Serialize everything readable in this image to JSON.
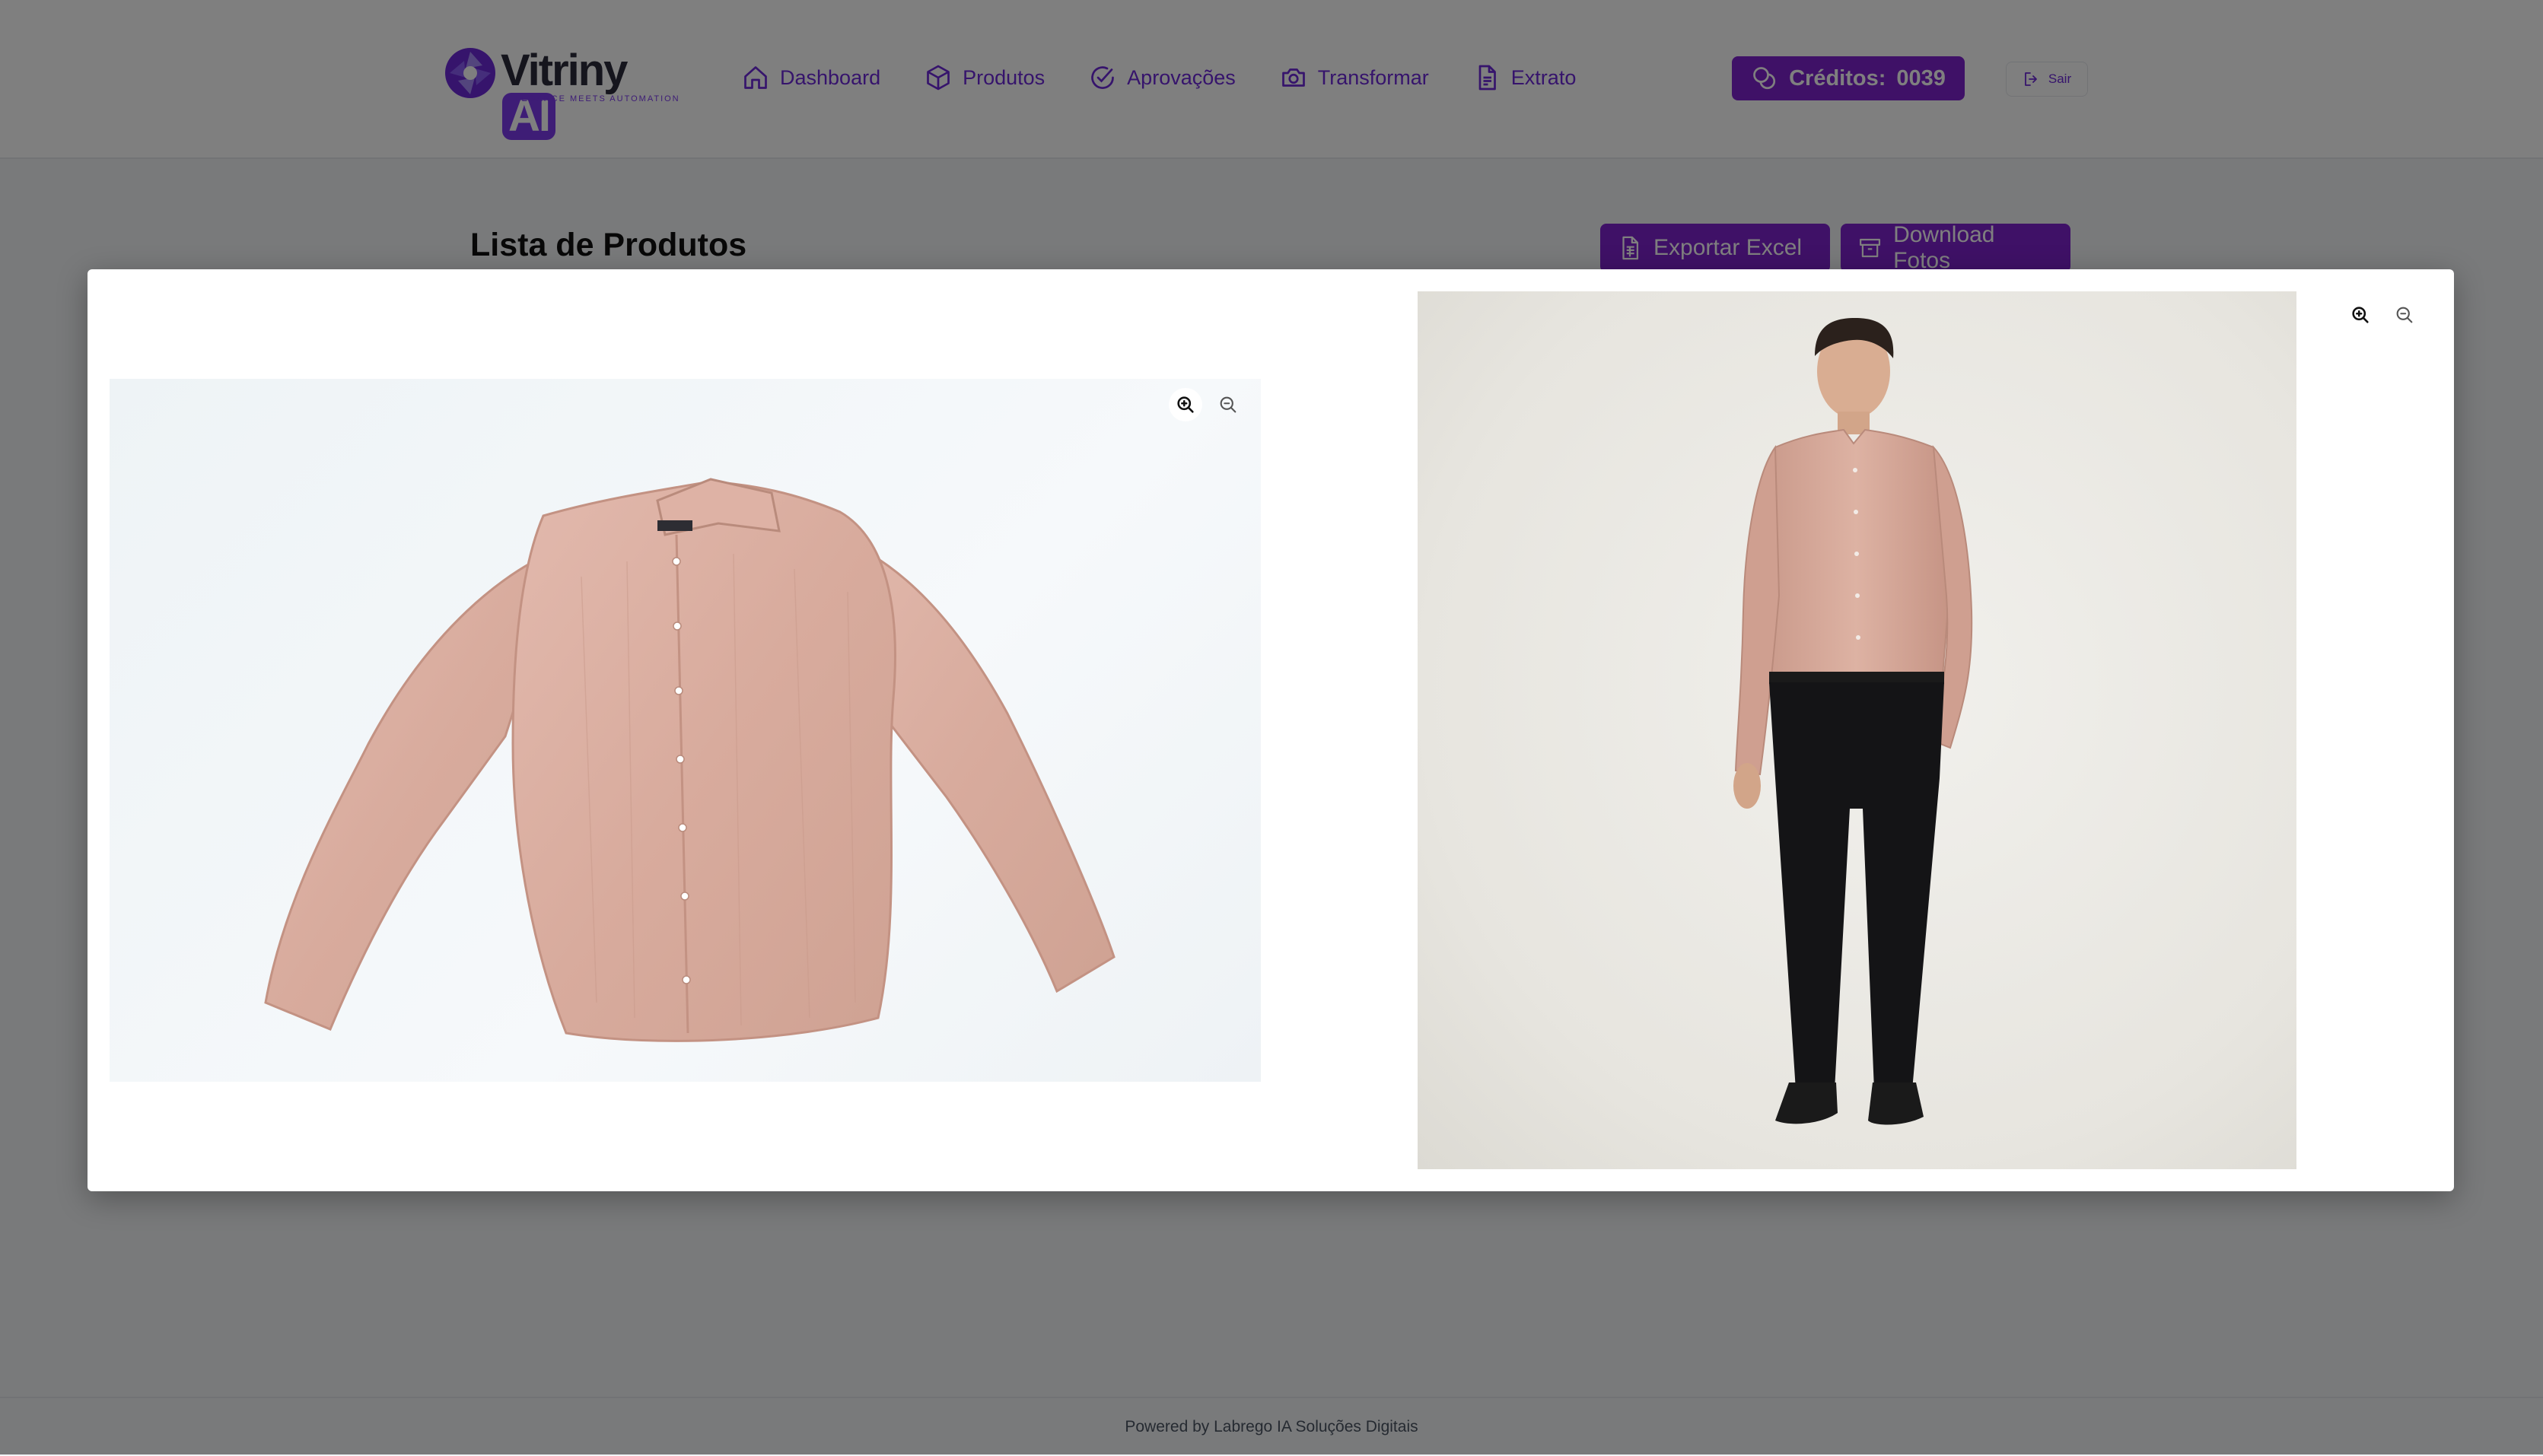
{
  "header": {
    "logo": {
      "word": "Vitriny",
      "badge": "AI",
      "tagline": "ELEGANCE MEETS AUTOMATION"
    },
    "nav": [
      {
        "label": "Dashboard",
        "icon": "home-icon"
      },
      {
        "label": "Produtos",
        "icon": "box-icon"
      },
      {
        "label": "Aprovações",
        "icon": "check-circle-icon"
      },
      {
        "label": "Transformar",
        "icon": "camera-icon"
      },
      {
        "label": "Extrato",
        "icon": "document-icon"
      }
    ],
    "credits": {
      "label": "Créditos:",
      "value": "0039",
      "icon": "coins-icon"
    },
    "logout": {
      "label": "Sair",
      "icon": "logout-icon"
    }
  },
  "main": {
    "title": "Lista de Produtos",
    "export_button": "Exportar Excel",
    "download_button": "Download Fotos"
  },
  "modal": {
    "left_image": {
      "subject": "flat-lay pink linen shirt",
      "zoom_in_icon": "zoom-in-icon",
      "zoom_out_icon": "zoom-out-icon"
    },
    "right_image": {
      "subject": "model wearing pink linen shirt and black trousers",
      "zoom_in_icon": "zoom-in-icon",
      "zoom_out_icon": "zoom-out-icon"
    }
  },
  "footer": {
    "text": "Powered by Labrego IA Soluções Digitais"
  },
  "colors": {
    "accent": "#7e22ce",
    "nav_text": "#6d28d9",
    "overlay": "rgba(0,0,0,0.5)"
  }
}
